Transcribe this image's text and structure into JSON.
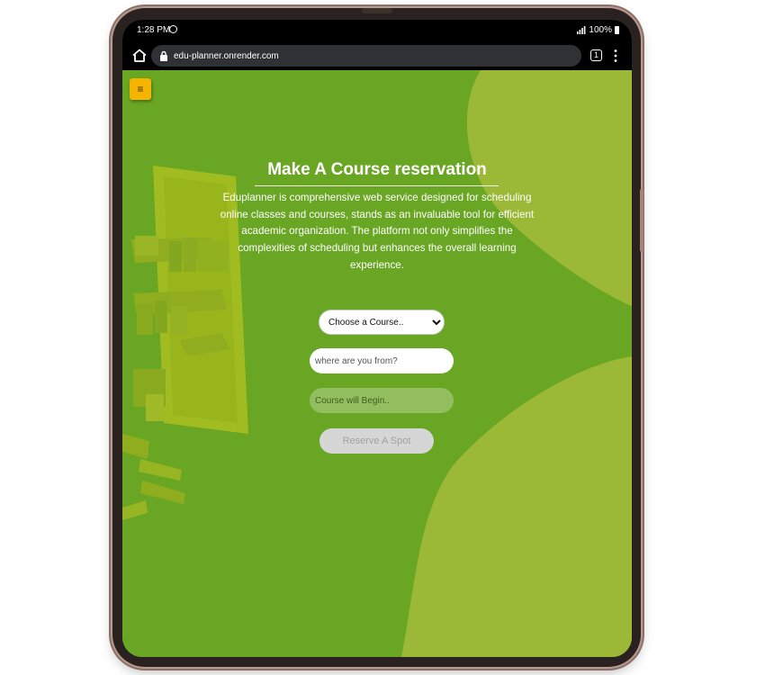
{
  "status_bar": {
    "time": "1:28 PM",
    "battery": "100%"
  },
  "browser": {
    "url": "edu-planner.onrender.com",
    "tab_count": "1"
  },
  "page": {
    "menu_icon": "≡",
    "title": "Make A Course reservation",
    "description": "Eduplanner is comprehensive web service designed for scheduling online classes and courses, stands as an invaluable tool for efficient academic organization. The platform not only simplifies the complexities of scheduling but enhances the overall learning experience.",
    "course_select_value": "Choose a Course..",
    "origin_placeholder": "where are you from?",
    "start_placeholder": "Course will Begin..",
    "reserve_label": "Reserve A Spot"
  },
  "colors": {
    "background": "#69a623",
    "wave": "#9bb937",
    "menu_button": "#f5b400"
  },
  "icons": [
    "home-icon",
    "lock-icon",
    "tab-count-icon",
    "menu-dots-icon",
    "hamburger-icon",
    "signal-icon",
    "battery-icon",
    "spotify-icon"
  ]
}
